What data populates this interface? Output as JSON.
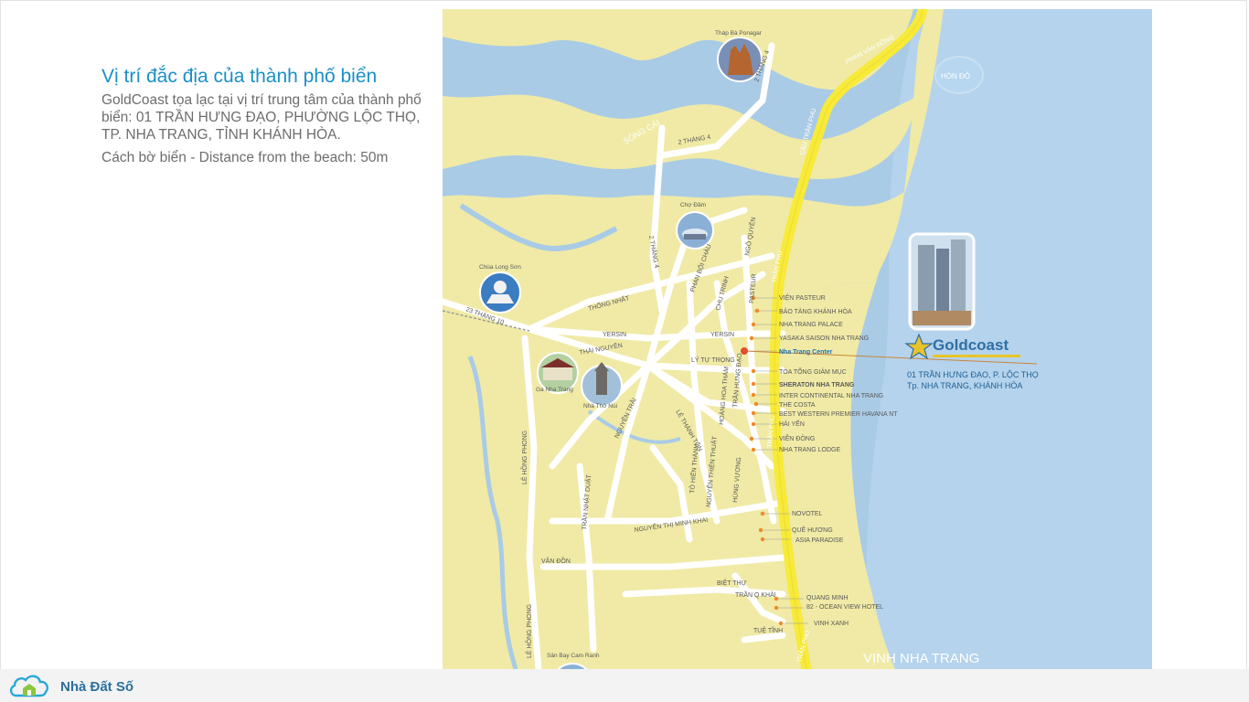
{
  "intro": {
    "title": "Vị trí đắc địa của thành phố biển",
    "description": "GoldCoast tọa lạc tại vị trí trung tâm của thành phố biển: 01 TRẦN HƯNG ĐẠO, PHƯỜNG LỘC THỌ, TP. NHA TRANG, TỈNH KHÁNH HÒA.",
    "distance": "Cách bờ biển - Distance from the beach: 50m"
  },
  "map": {
    "colors": {
      "sea": "#a9cbe6",
      "land": "#f0eaa6",
      "road": "#ffffff",
      "main_road": "#f7ea3a",
      "label": "#5a5a5a",
      "hotel_dot": "#f08a24",
      "center_dot": "#e0502a"
    },
    "sea_label": "VỊNH NHA TRANG",
    "island_label": "HÒN ĐỎ",
    "river_label": "SÔNG CÁI",
    "landmarks": [
      {
        "label": "Tháp Bà Ponagar",
        "icon": "temple-icon"
      },
      {
        "label": "Chợ Đầm",
        "icon": "market-icon"
      },
      {
        "label": "Chùa Long Sơn",
        "icon": "pagoda-icon"
      },
      {
        "label": "Ga Nha Trang",
        "icon": "station-icon"
      },
      {
        "label": "Nhà Thờ Núi",
        "icon": "church-icon"
      },
      {
        "label": "Sân Bay Cam Ranh",
        "icon": "airport-icon"
      }
    ],
    "streets": [
      "PHẠM VĂN ĐỒNG",
      "CẦU TRẦN PHÚ",
      "TRẦN PHÚ",
      "TRẦN PHÚ",
      "TRẦN PHÚ",
      "2 THÁNG 4",
      "2 THÁNG 4",
      "2 THÁNG 4",
      "THỐNG NHẤT",
      "23 THÁNG 10",
      "YERSIN",
      "YERSIN",
      "THÁI NGUYÊN",
      "PHAN BỘI CHÂU",
      "NGÔ QUYỀN",
      "CHU TRINH",
      "PASTEUR",
      "LÝ TỰ TRỌNG",
      "TRẦN HƯNG ĐẠO",
      "HOÀNG HOA THÁM",
      "NGUYỄN TRÃI",
      "LÊ THÁNH TÔN",
      "HÙNG VƯƠNG",
      "TÔ HIẾN THÀNH",
      "NGUYỄN THIỆN THUẬT",
      "LÊ HỒNG PHONG",
      "LÊ HỒNG PHONG",
      "TRẦN NHẬT DUẬT",
      "NGUYỄN THỊ MINH KHAI",
      "VÂN ĐỒN",
      "BIỆT THỰ",
      "TRẦN Q KHẢI",
      "TUỆ TĨNH"
    ],
    "places": [
      "VIỆN PASTEUR",
      "BẢO TÀNG KHÁNH HÒA",
      "NHA TRANG PALACE",
      "YASAKA SAISON NHA TRANG",
      "Nha Trang Center",
      "TÒA TỔNG GIÁM MỤC",
      "SHERATON NHA TRANG",
      "INTER CONTINENTAL NHA TRANG",
      "THE COSTA",
      "BEST WESTERN PREMIER HAVANA NT",
      "HẢI YẾN",
      "VIỄN ĐÔNG",
      "NHA TRANG LODGE",
      "NOVOTEL",
      "QUÊ HƯƠNG",
      "ASIA PARADISE",
      "QUANG MINH",
      "82 - OCEAN VIEW HOTEL",
      "VINH XANH"
    ],
    "project": {
      "brand": "Goldcoast",
      "address_line1": "01 TRẦN HƯNG ĐẠO, P. LỘC THỌ",
      "address_line2": "Tp. NHA TRANG, KHÁNH HÒA"
    }
  },
  "footer": {
    "logo_text": "Nhà Đất Số"
  }
}
